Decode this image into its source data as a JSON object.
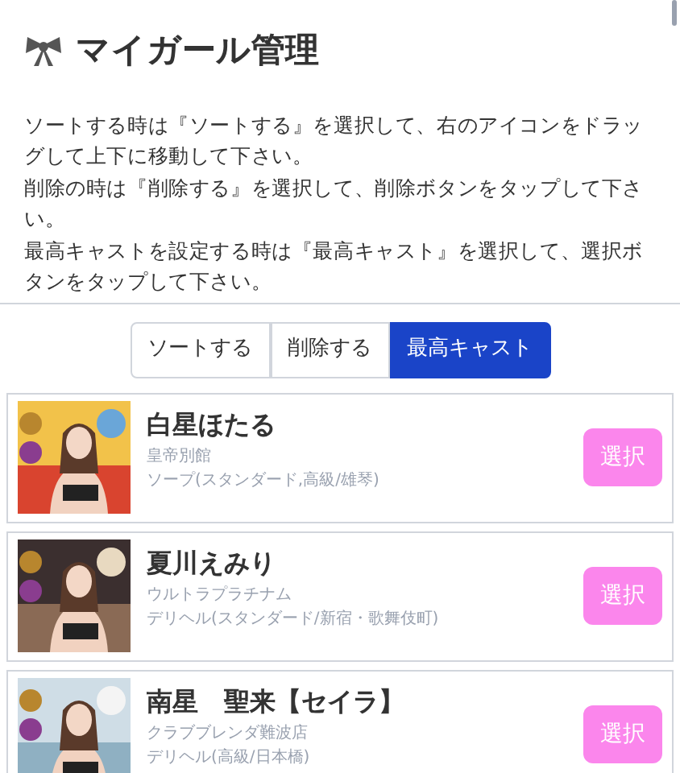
{
  "header": {
    "title": "マイガール管理"
  },
  "instructions": [
    "ソートする時は『ソートする』を選択して、右のアイコンをドラッグして上下に移動して下さい。",
    "削除の時は『削除する』を選択して、削除ボタンをタップして下さい。",
    "最高キャストを設定する時は『最高キャスト』を選択して、選択ボタンをタップして下さい。"
  ],
  "mode_tabs": [
    {
      "label": "ソートする",
      "selected": false
    },
    {
      "label": "削除する",
      "selected": false
    },
    {
      "label": "最高キャスト",
      "selected": true
    }
  ],
  "girls": [
    {
      "name": "白星ほたる",
      "shop": "皇帝別館",
      "category": "ソープ(スタンダード,高級/雄琴)",
      "button": "選択"
    },
    {
      "name": "夏川えみり",
      "shop": "ウルトラプラチナム",
      "category": "デリヘル(スタンダード/新宿・歌舞伎町)",
      "button": "選択"
    },
    {
      "name": "南星　聖来【セイラ】",
      "shop": "クラブブレンダ難波店",
      "category": "デリヘル(高級/日本橋)",
      "button": "選択"
    }
  ]
}
